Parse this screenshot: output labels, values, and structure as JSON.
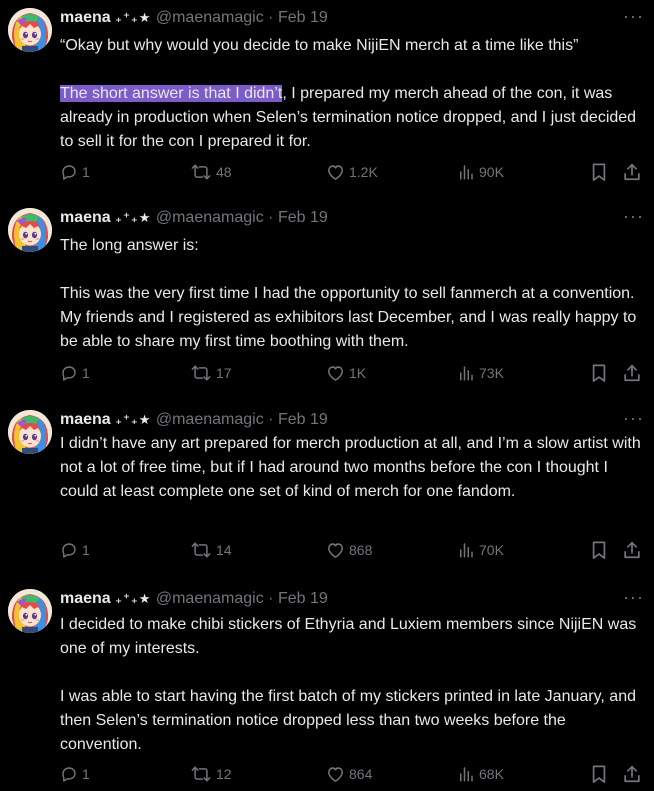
{
  "colors": {
    "background": "#000000",
    "text": "#e7e9ea",
    "secondary": "#71767b",
    "selection": "#7b5cc9"
  },
  "icons": {
    "reply": "reply-icon",
    "retweet": "retweet-icon",
    "like": "like-icon",
    "views": "views-icon",
    "bookmark": "bookmark-icon",
    "share": "share-icon",
    "more": "more-icon"
  },
  "tweets": [
    {
      "author": {
        "name": "maena",
        "decoration": "₊⁺₊★",
        "handle": "@maenamagic",
        "separator": "·",
        "date": "Feb 19"
      },
      "more": "···",
      "text_before": "“Okay but why would you decide to make NijiEN merch at a time like this”\n\n",
      "highlight": "The short answer is that I didn’t",
      "text_after": ", I prepared my merch ahead of the con, it was already in production when Selen’s termination notice dropped, and I just decided to sell it for the con I prepared it for.",
      "stats": {
        "replies": "1",
        "retweets": "48",
        "likes": "1.2K",
        "views": "90K"
      }
    },
    {
      "author": {
        "name": "maena",
        "decoration": "₊⁺₊★",
        "handle": "@maenamagic",
        "separator": "·",
        "date": "Feb 19"
      },
      "more": "···",
      "text": "The long answer is:\n\nThis was the very first time I had the opportunity to sell fanmerch at a convention. My friends and I registered as exhibitors last December, and I was really happy to be able to share my first time boothing with them.",
      "stats": {
        "replies": "1",
        "retweets": "17",
        "likes": "1K",
        "views": "73K"
      }
    },
    {
      "author": {
        "name": "maena",
        "decoration": "₊⁺₊★",
        "handle": "@maenamagic",
        "separator": "·",
        "date": "Feb 19"
      },
      "more": "···",
      "text": "I didn’t have any art prepared for merch production at all, and I’m a slow artist with not a lot of free time, but if I had around two months before the con I thought I could at least complete one set of kind of merch for one fandom.",
      "stats": {
        "replies": "1",
        "retweets": "14",
        "likes": "868",
        "views": "70K"
      }
    },
    {
      "author": {
        "name": "maena",
        "decoration": "₊⁺₊★",
        "handle": "@maenamagic",
        "separator": "·",
        "date": "Feb 19"
      },
      "more": "···",
      "text": "I decided to make chibi stickers of Ethyria and Luxiem members since NijiEN was one of my interests.\n\nI was able to start having the first batch of my stickers printed in late January, and then Selen’s termination notice dropped less than two weeks before the convention.",
      "stats": {
        "replies": "1",
        "retweets": "12",
        "likes": "864",
        "views": "68K"
      }
    }
  ]
}
